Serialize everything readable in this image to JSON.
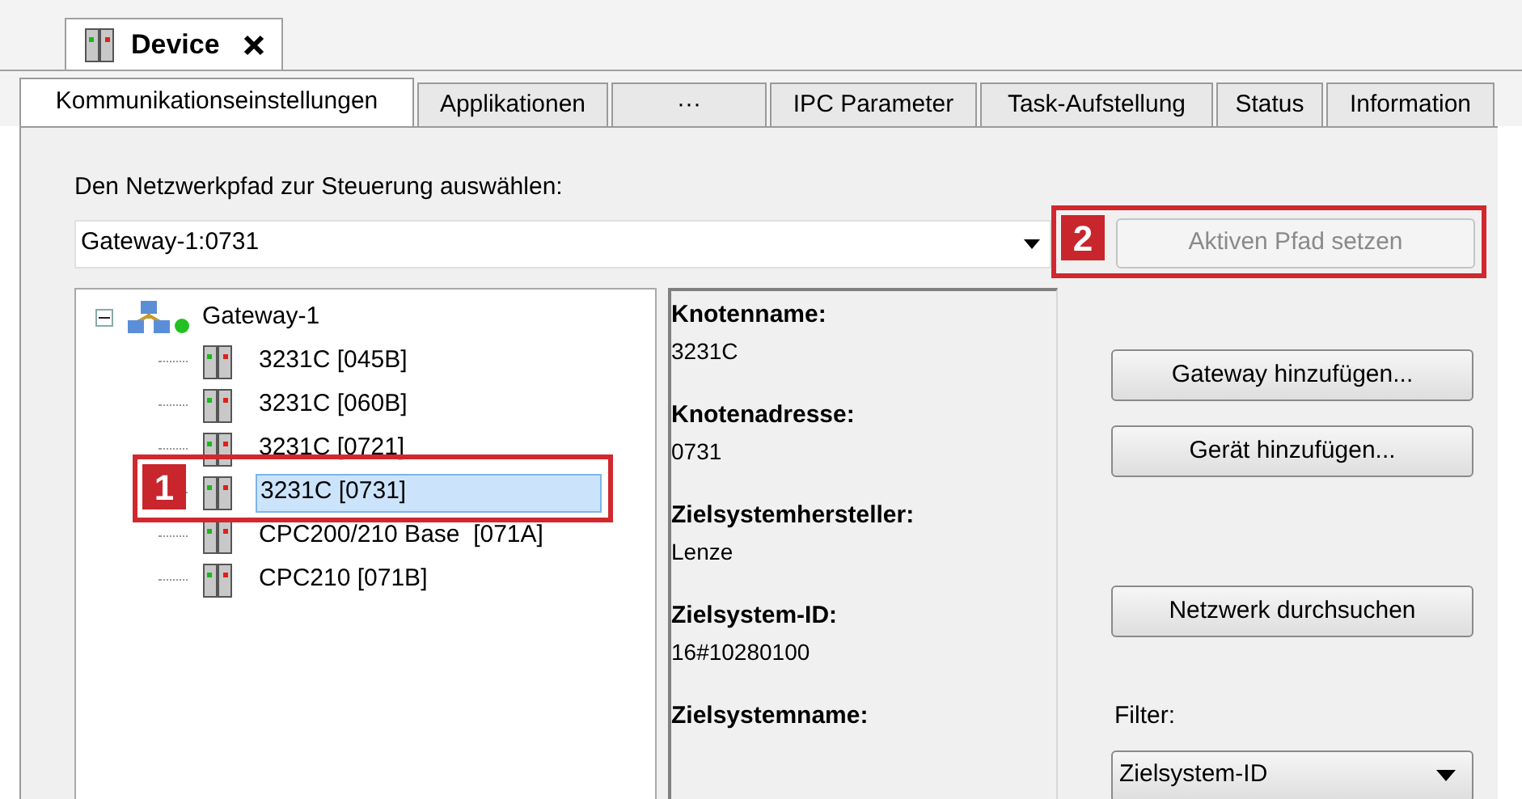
{
  "document_tab": {
    "title": "Device",
    "selected": true
  },
  "tabs": [
    {
      "label": "Kommunikationseinstellungen",
      "selected": true
    },
    {
      "label": "Applikationen",
      "selected": false
    },
    {
      "label": "···",
      "selected": false
    },
    {
      "label": "IPC Parameter",
      "selected": false
    },
    {
      "label": "Task-Aufstellung",
      "selected": false
    },
    {
      "label": "Status",
      "selected": false
    },
    {
      "label": "Information",
      "selected": false
    }
  ],
  "path_label": "Den Netzwerkpfad zur Steuerung auswählen:",
  "path_field": {
    "value": "Gateway-1:0731"
  },
  "set_path_button": {
    "label": "Aktiven Pfad setzen",
    "disabled": true
  },
  "tree": [
    {
      "label": "Gateway-1",
      "kind": "gateway",
      "online": true,
      "expanded": true,
      "selected": false,
      "children": [
        {
          "label": "3231C [045B]",
          "kind": "device",
          "selected": false
        },
        {
          "label": "3231C [060B]",
          "kind": "device",
          "selected": false
        },
        {
          "label": "3231C [0721]",
          "kind": "device",
          "selected": false
        },
        {
          "label": "3231C [0731]",
          "kind": "device",
          "selected": true
        },
        {
          "label": "CPC200/210 Base  [071A]",
          "kind": "device",
          "selected": false
        },
        {
          "label": "CPC210 [071B]",
          "kind": "device",
          "selected": false
        }
      ]
    }
  ],
  "details": [
    {
      "label": "Knotenname:",
      "value": "3231C"
    },
    {
      "label": "Knotenadresse:",
      "value": "0731"
    },
    {
      "label": "Zielsystemhersteller:",
      "value": "Lenze"
    },
    {
      "label": "Zielsystem-ID:",
      "value": "16#10280100"
    },
    {
      "label": "Zielsystemname:"
    }
  ],
  "buttons": [
    {
      "label": "Gateway hinzufügen..."
    },
    {
      "label": "Gerät hinzufügen..."
    },
    {
      "label": "Netzwerk durchsuchen"
    }
  ],
  "filter": {
    "label": "Filter:",
    "value": "Zielsystem-ID"
  },
  "callouts": [
    {
      "number": "1"
    },
    {
      "number": "2"
    }
  ]
}
